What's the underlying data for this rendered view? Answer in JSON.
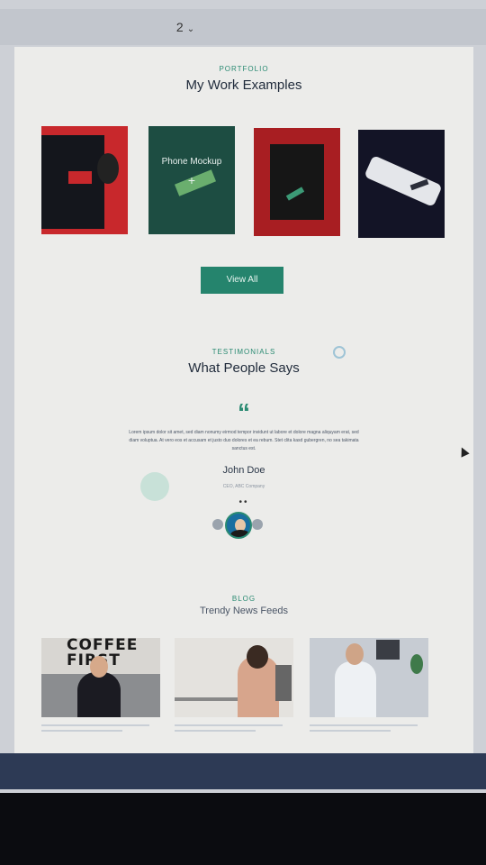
{
  "toolbar": {
    "page_number": "2",
    "chevron": "chevron-down-icon"
  },
  "portfolio": {
    "eyebrow": "PORTFOLIO",
    "title": "My Work Examples",
    "items": [
      {
        "label": ""
      },
      {
        "label": "Phone Mockup",
        "icon": "plus-icon",
        "plus": "+"
      },
      {
        "label": ""
      },
      {
        "label": ""
      }
    ],
    "view_all_label": "View All"
  },
  "testimonials": {
    "eyebrow": "TESTIMONIALS",
    "title": "What People Says",
    "quote_icon": "quote-icon",
    "quote_glyph": "“",
    "quote": "Lorem ipsum dolor sit amet, sed diam nonumy eirmod tempor invidunt ut labore et dolore magna aliquyam erat, sed diam voluptua. At vero eos et accusam et justo duo dolores et ea rebum. Stet clita kasd gubergren, no sea takimata sanctus est.",
    "name": "John Doe",
    "role": "CEO, ABC Company",
    "dots": "••"
  },
  "news": {
    "eyebrow": "BLOG",
    "title": "Trendy News Feeds",
    "cards": [
      {
        "image_text": "COFFEE FIRST"
      },
      {
        "image_text": ""
      },
      {
        "image_text": ""
      }
    ]
  },
  "colors": {
    "accent": "#25846d",
    "page_bg": "#ececea",
    "title": "#1f2a3a"
  }
}
